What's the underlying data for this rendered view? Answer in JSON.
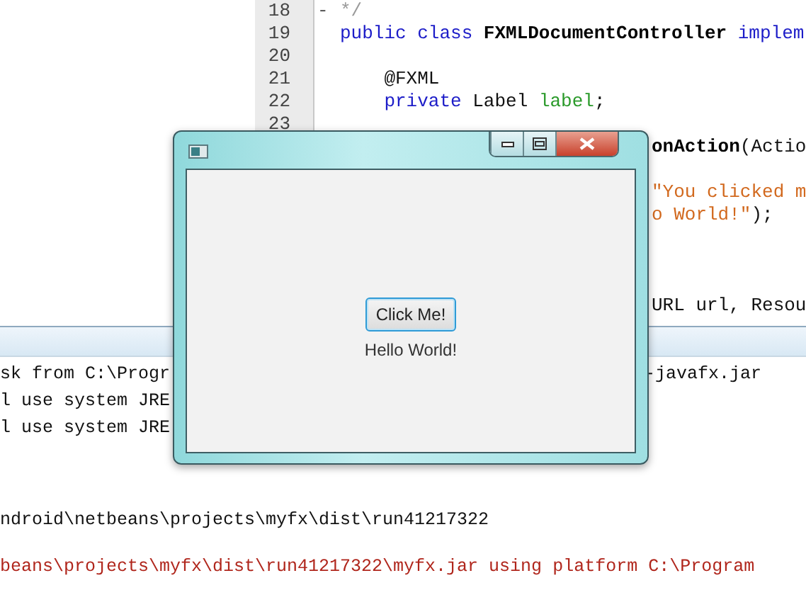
{
  "editor": {
    "lines": [
      {
        "number": "18",
        "fold_marker": "-",
        "code": [
          {
            "kind": "comment",
            "text": "*/"
          }
        ]
      },
      {
        "number": "19",
        "code": [
          {
            "kind": "keyword",
            "text": "public class "
          },
          {
            "kind": "bold",
            "text": "FXMLDocumentController"
          },
          {
            "kind": "keyword",
            "text": " implem"
          }
        ]
      },
      {
        "number": "20"
      },
      {
        "number": "21",
        "code": [
          {
            "kind": "plain",
            "text": "    @FXML"
          }
        ]
      },
      {
        "number": "22",
        "code": [
          {
            "kind": "keyword",
            "text": "    private "
          },
          {
            "kind": "plain",
            "text": "Label "
          },
          {
            "kind": "field",
            "text": "label"
          },
          {
            "kind": "plain",
            "text": ";"
          }
        ]
      },
      {
        "number": "23"
      }
    ],
    "right_of_window": [
      [
        {
          "kind": "bold",
          "text": "onAction"
        },
        {
          "kind": "plain",
          "text": "(Actio"
        }
      ],
      [
        {
          "kind": "string",
          "text": "\"You clicked m"
        }
      ],
      [
        {
          "kind": "string",
          "text": "o World!\""
        },
        {
          "kind": "plain",
          "text": ");"
        }
      ],
      [
        {
          "kind": "plain",
          "text": "URL url, Resou"
        }
      ]
    ]
  },
  "output": {
    "lines": [
      {
        "left": "sk from C:\\Progr",
        "right": "-javafx.jar"
      },
      {
        "left": "l use system JRE"
      },
      {
        "left": "l use system JRE"
      }
    ],
    "log": [
      {
        "kind": "info",
        "text": "ndroid\\netbeans\\projects\\myfx\\dist\\run41217322"
      },
      {
        "kind": "error",
        "text": "beans\\projects\\myfx\\dist\\run41217322\\myfx.jar using platform C:\\Program"
      }
    ]
  },
  "window": {
    "button": "Click Me!",
    "label": "Hello World!"
  }
}
